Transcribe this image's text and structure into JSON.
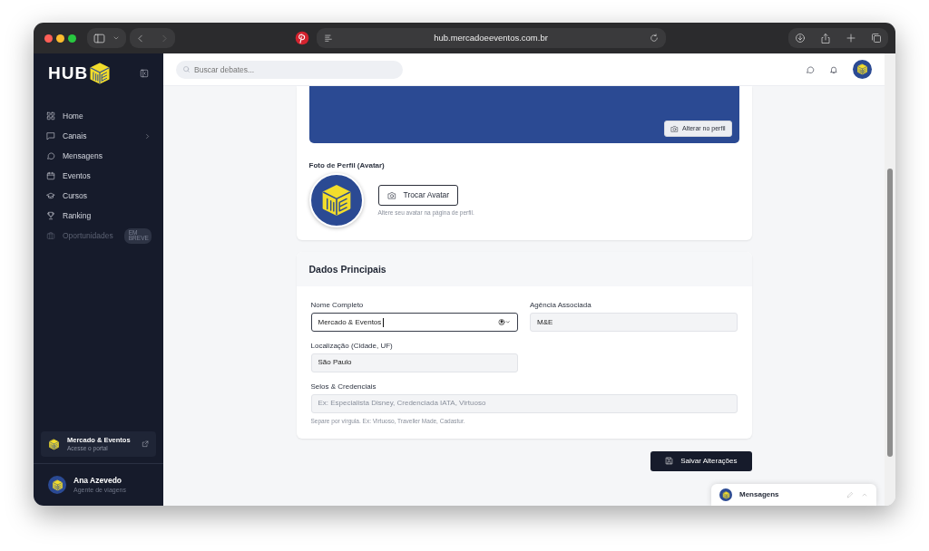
{
  "browser": {
    "url": "hub.mercadoeeventos.com.br"
  },
  "sidebar": {
    "logo": "HUB",
    "items": [
      {
        "label": "Home",
        "expandable": false,
        "disabled": false
      },
      {
        "label": "Canais",
        "expandable": true,
        "disabled": false
      },
      {
        "label": "Mensagens",
        "expandable": false,
        "disabled": false
      },
      {
        "label": "Eventos",
        "expandable": false,
        "disabled": false
      },
      {
        "label": "Cursos",
        "expandable": false,
        "disabled": false
      },
      {
        "label": "Ranking",
        "expandable": false,
        "disabled": false
      },
      {
        "label": "Oportunidades",
        "expandable": false,
        "disabled": true,
        "badge": "EM BREVE"
      }
    ],
    "portal": {
      "title": "Mercado & Eventos",
      "subtitle": "Acesse o portal"
    },
    "user": {
      "name": "Ana Azevedo",
      "role": "Agente de viagens"
    }
  },
  "header": {
    "search": {
      "placeholder": "Buscar debates..."
    }
  },
  "profile_card": {
    "banner_button": "Alterar no perfil",
    "avatar_label": "Foto de Perfil (Avatar)",
    "avatar_button": "Trocar Avatar",
    "avatar_help": "Altere seu avatar na página de perfil."
  },
  "main_data": {
    "title": "Dados Principais",
    "fields": [
      {
        "label": "Nome Completo",
        "value": "Mercado & Eventos",
        "focused": true,
        "kind": "half"
      },
      {
        "label": "Agência Associada",
        "value": "M&E",
        "focused": false,
        "kind": "half"
      },
      {
        "label": "Localização (Cidade, UF)",
        "value": "São Paulo",
        "focused": false,
        "kind": "half"
      },
      {
        "label": "Selos & Credenciais",
        "placeholder": "Ex: Especialista Disney, Credenciada IATA, Virtuoso",
        "help": "Separe por vírgula. Ex: Virtuoso, Traveller Made, Cadastur.",
        "focused": false,
        "kind": "full"
      }
    ]
  },
  "save_button": "Salvar Alterações",
  "chat_widget": {
    "title": "Mensagens"
  }
}
